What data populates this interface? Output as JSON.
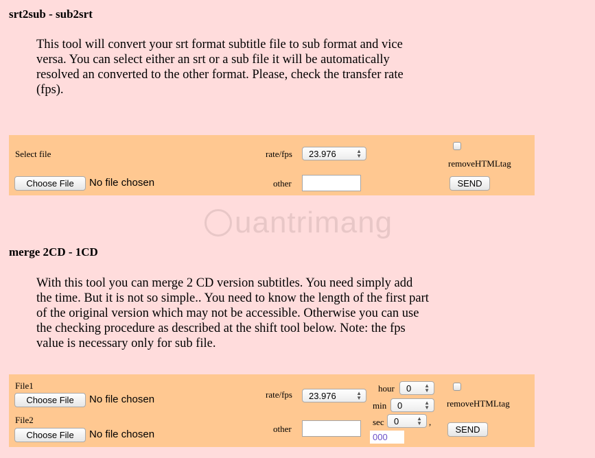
{
  "section1": {
    "title": "srt2sub - sub2srt",
    "description_lines": [
      "This tool will convert your srt format subtitle file to sub format and vice",
      "versa. You can select either an srt or a sub file it will be automatically",
      "resolved an converted to the other format. Please, check the transfer rate",
      "(fps)."
    ],
    "select_file_label": "Select file",
    "choose_file_label": "Choose File",
    "no_file_text": "No file chosen",
    "rate_label": "rate/fps",
    "rate_value": "23.976",
    "other_label": "other",
    "other_value": "",
    "remove_html_label": "removeHTMLtag",
    "send_label": "SEND"
  },
  "watermark": {
    "text": "uantrimang"
  },
  "section2": {
    "title": "merge 2CD - 1CD",
    "description_lines": [
      "With this tool you can merge 2 CD version subtitles. You need simply add",
      "the time. But it is not so simple.. You need to know the length of the first part",
      "of the original version which may not be accessible. Otherwise you can use",
      "the checking procedure as described at the shift tool below. Note: the fps",
      "value is necessary only for sub file."
    ],
    "file1_label": "File1",
    "file2_label": "File2",
    "choose_file_label": "Choose File",
    "no_file_text": "No file chosen",
    "rate_label": "rate/fps",
    "rate_value": "23.976",
    "other_label": "other",
    "other_value": "",
    "hour_label": "hour",
    "hour_value": "0",
    "min_label": "min",
    "min_value": "0",
    "sec_label": "sec",
    "sec_value": "0",
    "comma": ",",
    "ms_value": "000",
    "remove_html_label": "removeHTMLtag",
    "send_label": "SEND"
  }
}
